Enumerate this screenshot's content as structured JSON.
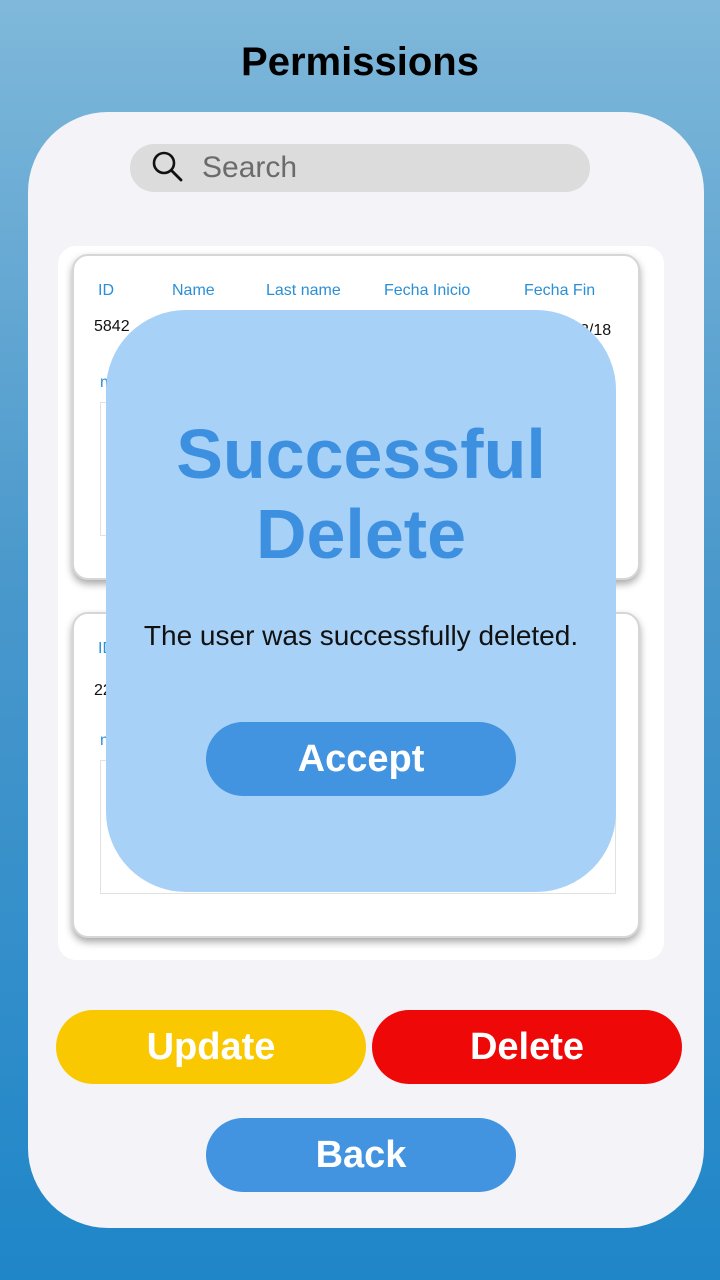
{
  "page_title": "Permissions",
  "search": {
    "placeholder": "Search"
  },
  "table": {
    "columns": [
      "ID",
      "Name",
      "Last name",
      "Fecha Inicio",
      "Fecha Fin"
    ],
    "rows": [
      {
        "id": "5842",
        "fecha_fin_partial": "2/18"
      },
      {
        "id": "22"
      }
    ]
  },
  "modal": {
    "title": "Successful Delete",
    "message": "The user was successfully deleted.",
    "accept_label": "Accept"
  },
  "actions": {
    "update_label": "Update",
    "delete_label": "Delete",
    "back_label": "Back"
  },
  "colors": {
    "accent_blue": "#4293e0",
    "update_yellow": "#f9c800",
    "delete_red": "#ef0808",
    "modal_bg": "#a8d1f7",
    "header_blue": "#2a8fd6"
  }
}
